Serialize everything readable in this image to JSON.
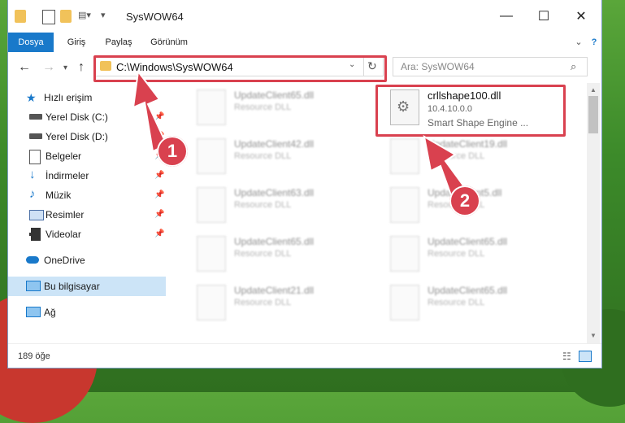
{
  "window": {
    "title": "SysWOW64"
  },
  "ribbon": {
    "tabs": [
      "Dosya",
      "Giriş",
      "Paylaş",
      "Görünüm"
    ]
  },
  "nav": {
    "address": "C:\\Windows\\SysWOW64",
    "search_placeholder": "Ara: SysWOW64"
  },
  "sidebar": {
    "items": [
      {
        "label": "Hızlı erişim",
        "icon": "star-icon"
      },
      {
        "label": "Yerel Disk (C:)",
        "icon": "drive-icon"
      },
      {
        "label": "Yerel Disk (D:)",
        "icon": "drive-icon"
      },
      {
        "label": "Belgeler",
        "icon": "documents-icon"
      },
      {
        "label": "İndirmeler",
        "icon": "download-icon"
      },
      {
        "label": "Müzik",
        "icon": "music-icon"
      },
      {
        "label": "Resimler",
        "icon": "pictures-icon"
      },
      {
        "label": "Videolar",
        "icon": "video-icon"
      },
      {
        "label": "OneDrive",
        "icon": "cloud-icon"
      },
      {
        "label": "Bu bilgisayar",
        "icon": "computer-icon"
      },
      {
        "label": "Ağ",
        "icon": "network-icon"
      }
    ]
  },
  "files": {
    "highlight": {
      "name": "crllshape100.dll",
      "version": "10.4.10.0.0",
      "desc": "Smart Shape Engine ..."
    },
    "items": [
      {
        "name": "UpdateClient65.dll",
        "desc": "Resource DLL"
      },
      {
        "name": "UpdateClient42.dll",
        "desc": "Resource DLL"
      },
      {
        "name": "UpdateClient19.dll",
        "desc": "Resource DLL"
      },
      {
        "name": "UpdateClient63.dll",
        "desc": "Resource DLL"
      },
      {
        "name": "UpdateClient5.dll",
        "desc": "Resource DLL"
      },
      {
        "name": "UpdateClient65.dll",
        "desc": "Resource DLL"
      },
      {
        "name": "UpdateClient65.dll",
        "desc": "Resource DLL"
      },
      {
        "name": "UpdateClient21.dll",
        "desc": "Resource DLL"
      },
      {
        "name": "UpdateClient65.dll",
        "desc": "Resource DLL"
      }
    ]
  },
  "status": {
    "count": "189 öğe"
  },
  "annotations": {
    "step1": "1",
    "step2": "2",
    "color": "#d9414f"
  }
}
